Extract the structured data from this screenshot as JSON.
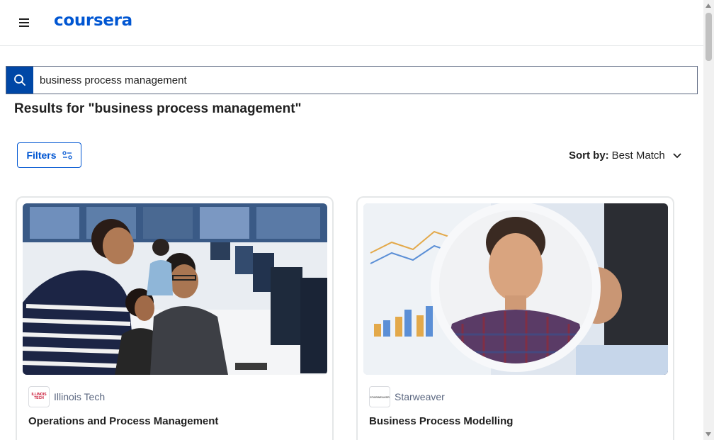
{
  "header": {
    "logo": "coursera",
    "menu_icon": "hamburger-menu-icon"
  },
  "search": {
    "value": "business process management",
    "icon": "search-icon"
  },
  "results": {
    "title": "Results for \"business process management\""
  },
  "filters": {
    "label": "Filters",
    "icon": "sliders-icon"
  },
  "sort": {
    "prefix": "Sort by:",
    "value": "Best Match",
    "icon": "chevron-down-icon"
  },
  "cards": [
    {
      "partner": "Illinois Tech",
      "partner_logo_text": "ILLINOIS TECH",
      "title": "Operations and Process Management",
      "image": "students-at-computers-photo"
    },
    {
      "partner": "Starweaver",
      "partner_logo_text": "STARWEAVER",
      "title": "Business Process Modelling",
      "image": "instructor-portrait-over-charts-photo"
    }
  ],
  "colors": {
    "brand": "#0056d2",
    "search_button": "#0047a6",
    "text": "#1f1f1f",
    "muted": "#5b6780"
  }
}
